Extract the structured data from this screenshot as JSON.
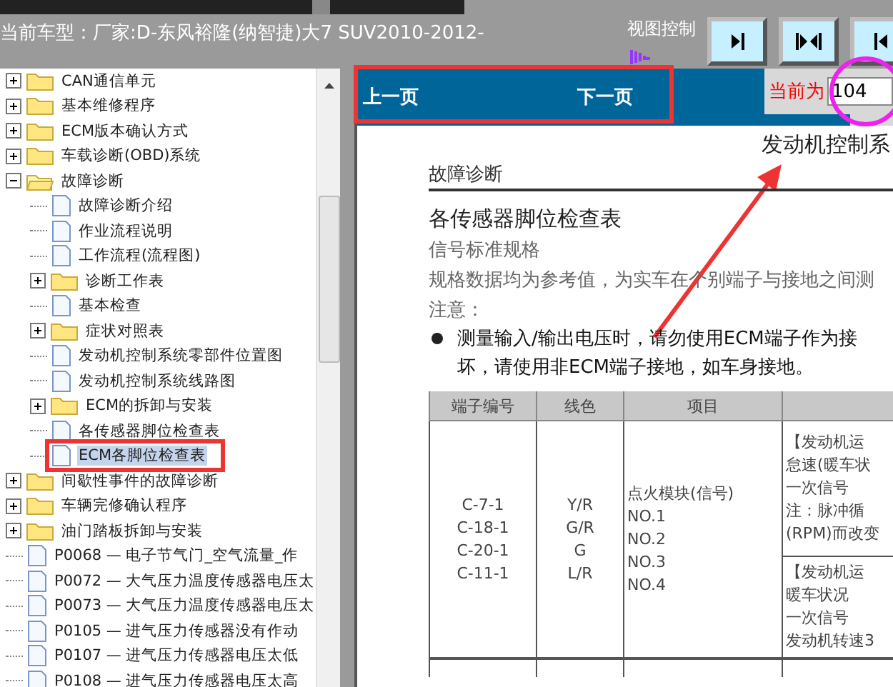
{
  "header": {
    "vehicle": "当前车型：厂家:D-东风裕隆(纳智捷)大7 SUV2010-2012-",
    "view_control_label": "视图控制",
    "view_buttons": [
      {
        "kind": "right"
      },
      {
        "kind": "both"
      },
      {
        "kind": "left"
      }
    ]
  },
  "tree": [
    {
      "label": "CAN通信单元",
      "kind": "folder",
      "expanded": false,
      "selected": false
    },
    {
      "label": "基本维修程序",
      "kind": "folder",
      "expanded": false,
      "selected": false
    },
    {
      "label": "ECM版本确认方式",
      "kind": "folder",
      "expanded": false,
      "selected": false
    },
    {
      "label": "车载诊断(OBD)系统",
      "kind": "folder",
      "expanded": false,
      "selected": false
    },
    {
      "label": "故障诊断",
      "kind": "folder",
      "expanded": true,
      "selected": false,
      "children": [
        {
          "label": "故障诊断介绍",
          "kind": "doc",
          "selected": false
        },
        {
          "label": "作业流程说明",
          "kind": "doc",
          "selected": false
        },
        {
          "label": "工作流程(流程图)",
          "kind": "doc",
          "selected": false
        },
        {
          "label": "诊断工作表",
          "kind": "folder",
          "expanded": false,
          "selected": false
        },
        {
          "label": "基本检查",
          "kind": "doc",
          "selected": false
        },
        {
          "label": "症状对照表",
          "kind": "folder",
          "expanded": false,
          "selected": false
        },
        {
          "label": "发动机控制系统零部件位置图",
          "kind": "doc",
          "selected": false
        },
        {
          "label": "发动机控制系统线路图",
          "kind": "doc",
          "selected": false
        },
        {
          "label": "ECM的拆卸与安装",
          "kind": "folder",
          "expanded": false,
          "selected": false
        },
        {
          "label": "各传感器脚位检查表",
          "kind": "doc",
          "selected": false
        },
        {
          "label": "ECM各脚位检查表",
          "kind": "doc",
          "selected": true
        }
      ]
    },
    {
      "label": "间歇性事件的故障诊断",
      "kind": "folder",
      "expanded": false,
      "selected": false
    },
    {
      "label": "车辆完修确认程序",
      "kind": "folder",
      "expanded": false,
      "selected": false
    },
    {
      "label": "油门踏板拆卸与安装",
      "kind": "folder",
      "expanded": false,
      "selected": false
    },
    {
      "label": "P0068 — 电子节气门_空气流量_作",
      "kind": "doc",
      "selected": false
    },
    {
      "label": "P0072 — 大气压力温度传感器电压太",
      "kind": "doc",
      "selected": false
    },
    {
      "label": "P0073 — 大气压力温度传感器电压太",
      "kind": "doc",
      "selected": false
    },
    {
      "label": "P0105 — 进气压力传感器没有作动",
      "kind": "doc",
      "selected": false
    },
    {
      "label": "P0107 — 进气压力传感器电压太低",
      "kind": "doc",
      "selected": false
    },
    {
      "label": "P0108 — 进气压力传感器电压太高",
      "kind": "doc",
      "selected": false
    }
  ],
  "nav": {
    "prev": "上一页",
    "next": "下一页",
    "page_label": "当前为",
    "page_value": "104"
  },
  "document": {
    "running_title": "发动机控制系",
    "section": "故障诊断",
    "heading": "各传感器脚位检查表",
    "subheading": "信号标准规格",
    "paragraph": "规格数据均为参考值，为实车在个别端子与接地之间测",
    "note_label": "注意：",
    "bullet_lines": [
      "测量输入/输出电压时，请勿使用ECM端子作为接",
      "坏，请使用非ECM端子接地，如车身接地。"
    ],
    "table": {
      "columns": [
        "端子编号",
        "线色",
        "项目"
      ],
      "terminals": [
        "C-7-1",
        "C-18-1",
        "C-20-1",
        "C-11-1"
      ],
      "wire_colors": [
        "Y/R",
        "G/R",
        "G",
        "L/R"
      ],
      "items": [
        "点火模块(信号)",
        "NO.1",
        "NO.2",
        "NO.3",
        "NO.4"
      ],
      "conditions": [
        [
          "【发动机运",
          "怠速(暖车状",
          "一次信号",
          "注：脉冲循",
          "(RPM)而改变"
        ],
        [
          "【发动机运",
          "暖车状况",
          "一次信号",
          "发动机转速3"
        ]
      ]
    }
  }
}
